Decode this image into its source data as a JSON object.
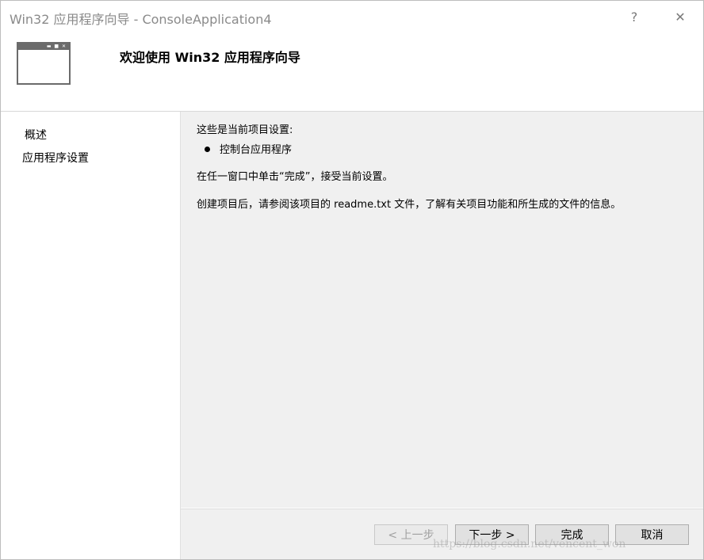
{
  "window": {
    "title": "Win32 应用程序向导 - ConsoleApplication4",
    "help_glyph": "?",
    "close_glyph": "✕"
  },
  "banner": {
    "heading": "欢迎使用 Win32 应用程序向导",
    "icon": "window-icon"
  },
  "nav": {
    "items": [
      {
        "label": "概述"
      },
      {
        "label": "应用程序设置"
      }
    ]
  },
  "content": {
    "intro": "这些是当前项目设置:",
    "bullets": [
      "控制台应用程序"
    ],
    "finish_hint": "在任一窗口中单击“完成”，接受当前设置。",
    "readme_hint": "创建项目后，请参阅该项目的 readme.txt 文件，了解有关项目功能和所生成的文件的信息。"
  },
  "footer": {
    "prev_label": "< 上一步",
    "next_label": "下一步 >",
    "finish_label": "完成",
    "cancel_label": "取消"
  },
  "watermark": "https://blog.csdn.net/vencent_won"
}
